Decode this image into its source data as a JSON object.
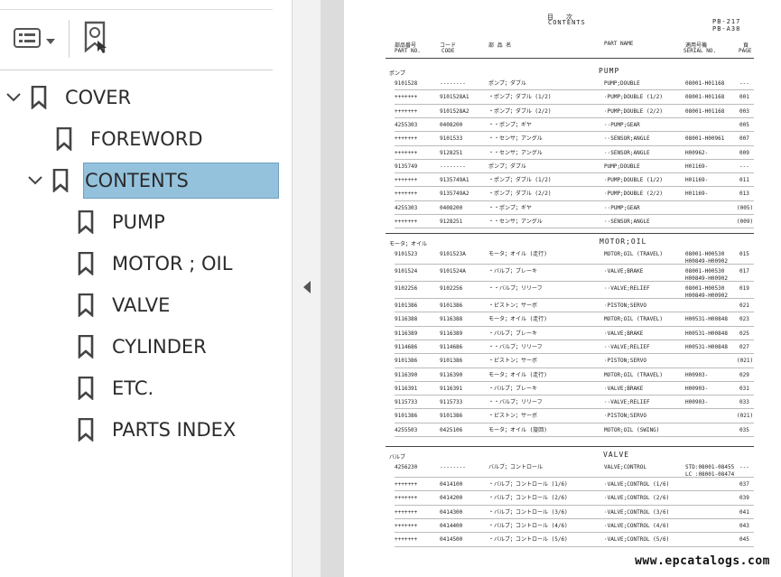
{
  "sidebar": {
    "toolbar": {
      "options_icon": "list-options-icon",
      "options_chevron": "chevron-down-icon",
      "find_bookmark_icon": "bookmark-search-icon"
    },
    "bookmarks": [
      {
        "label": "COVER",
        "level": 0,
        "expanded": true
      },
      {
        "label": "FOREWORD",
        "level": 1
      },
      {
        "label": "CONTENTS",
        "level": 1,
        "expanded": true,
        "selected": true
      },
      {
        "label": "PUMP",
        "level": 2
      },
      {
        "label": "MOTOR ; OIL",
        "level": 2
      },
      {
        "label": "VALVE",
        "level": 2
      },
      {
        "label": "CYLINDER",
        "level": 2
      },
      {
        "label": "ETC.",
        "level": 2
      },
      {
        "label": "PARTS INDEX",
        "level": 2
      }
    ],
    "collapse_icon": "triangle-left-icon"
  },
  "document": {
    "title_jp": "目　　次",
    "title_en": "CONTENTS",
    "code1": "PB-217",
    "code2": "PB-A38",
    "columns": {
      "part_no_jp": "部品番号",
      "part_no": "PART NO.",
      "code_jp": "コード",
      "code": "CODE",
      "name_jp": "部 品 名",
      "part_name": "PART NAME",
      "serial_jp": "適用号機",
      "serial": "SERIAL NO.",
      "page_jp": "頁",
      "page": "PAGE"
    },
    "sections": [
      {
        "jp": "ポンプ",
        "en": "PUMP",
        "rows": [
          [
            "9101528",
            "--------",
            "ポンプ；ダブル",
            "PUMP;DOUBLE",
            "08001-H01168",
            "---"
          ],
          [
            "+++++++",
            "9101528A1",
            "・ポンプ；ダブル (1/2)",
            "·PUMP;DOUBLE (1/2)",
            "08001-H01168",
            "001"
          ],
          [
            "+++++++",
            "9101528A2",
            "・ポンプ；ダブル (2/2)",
            "·PUMP;DOUBLE (2/2)",
            "08001-H01168",
            "003"
          ],
          [
            "4255303",
            "0408200",
            "・・ポンプ；ギヤ",
            "··PUMP;GEAR",
            "",
            "005"
          ],
          [
            "+++++++",
            "9101533",
            "・・センサ；アングル",
            "··SENSOR;ANGLE",
            "08001-H00961",
            "007"
          ],
          [
            "+++++++",
            "9128251",
            "・・センサ；アングル",
            "··SENSOR;ANGLE",
            "H00962-",
            "009"
          ],
          [
            "9135749",
            "--------",
            "ポンプ；ダブル",
            "PUMP;DOUBLE",
            "H01169-",
            "---"
          ],
          [
            "+++++++",
            "9135749A1",
            "・ポンプ；ダブル (1/2)",
            "·PUMP;DOUBLE (1/2)",
            "H01169-",
            "011"
          ],
          [
            "+++++++",
            "9135749A2",
            "・ポンプ；ダブル (2/2)",
            "·PUMP;DOUBLE (2/2)",
            "H01169-",
            "013"
          ],
          [
            "4255303",
            "0408200",
            "・・ポンプ；ギヤ",
            "··PUMP;GEAR",
            "",
            "(005)"
          ],
          [
            "+++++++",
            "9128251",
            "・・センサ；アングル",
            "··SENSOR;ANGLE",
            "",
            "(009)"
          ]
        ]
      },
      {
        "jp": "モータ；オイル",
        "en": "MOTOR;OIL",
        "rows": [
          [
            "9101523",
            "9101523A",
            "モータ；オイル (走行)",
            "MOTOR;OIL (TRAVEL)",
            "08001-H00530\nH00849-H00902",
            "015"
          ],
          [
            "9101524",
            "9101524A",
            "・バルブ；ブレーキ",
            "·VALVE;BRAKE",
            "08001-H00530\nH00849-H00902",
            "017"
          ],
          [
            "9102256",
            "9102256",
            "・・バルブ；リリーフ",
            "··VALVE;RELIEF",
            "08001-H00530\nH00849-H00902",
            "019"
          ],
          [
            "9101386",
            "9101386",
            "・ピストン；サーボ",
            "·PISTON;SERVO",
            "",
            "021"
          ],
          [
            "9116388",
            "9116388",
            "モータ；オイル (走行)",
            "MOTOR;OIL (TRAVEL)",
            "H00531-H00848",
            "023"
          ],
          [
            "9116389",
            "9116389",
            "・バルブ；ブレーキ",
            "·VALVE;BRAKE",
            "H00531-H00848",
            "025"
          ],
          [
            "9114686",
            "9114686",
            "・・バルブ；リリーフ",
            "··VALVE;RELIEF",
            "H00531-H00848",
            "027"
          ],
          [
            "9101386",
            "9101386",
            "・ピストン；サーボ",
            "·PISTON;SERVO",
            "",
            "(021)"
          ],
          [
            "9116390",
            "9116390",
            "モータ；オイル (走行)",
            "MOTOR;OIL (TRAVEL)",
            "H00903-",
            "029"
          ],
          [
            "9116391",
            "9116391",
            "・バルブ；ブレーキ",
            "·VALVE;BRAKE",
            "H00903-",
            "031"
          ],
          [
            "9115733",
            "9115733",
            "・・バルブ；リリーフ",
            "··VALVE;RELIEF",
            "H00903-",
            "033"
          ],
          [
            "9101386",
            "9101386",
            "・ピストン；サーボ",
            "·PISTON;SERVO",
            "",
            "(021)"
          ],
          [
            "4255503",
            "0425106",
            "モータ；オイル (旋回)",
            "MOTOR;OIL (SWING)",
            "",
            "035"
          ]
        ]
      },
      {
        "jp": "バルブ",
        "en": "VALVE",
        "rows": [
          [
            "4256230",
            "--------",
            "バルブ；コントロール",
            "VALVE;CONTROL",
            "STD:08001-08455\nLC :08001-08474",
            "---"
          ],
          [
            "+++++++",
            "0414100",
            "・バルブ；コントロール (1/6)",
            "·VALVE;CONTROL (1/6)",
            "",
            "037"
          ],
          [
            "+++++++",
            "0414200",
            "・バルブ；コントロール (2/6)",
            "·VALVE;CONTROL (2/6)",
            "",
            "039"
          ],
          [
            "+++++++",
            "0414300",
            "・バルブ；コントロール (3/6)",
            "·VALVE;CONTROL (3/6)",
            "",
            "041"
          ],
          [
            "+++++++",
            "0414400",
            "・バルブ；コントロール (4/6)",
            "·VALVE;CONTROL (4/6)",
            "",
            "043"
          ],
          [
            "+++++++",
            "0414500",
            "・バルブ；コントロール (5/6)",
            "·VALVE;CONTROL (5/6)",
            "",
            "045"
          ]
        ]
      }
    ],
    "watermark": "www.epcatalogs.com"
  }
}
